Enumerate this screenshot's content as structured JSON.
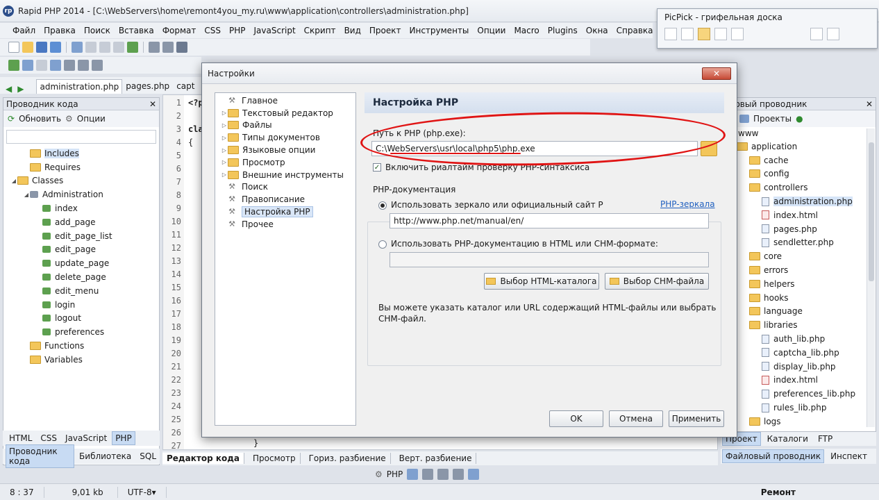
{
  "window": {
    "title": "Rapid PHP 2014 - [C:\\WebServers\\home\\remont4you_my.ru\\www\\application\\controllers\\administration.php]",
    "logo": "rp"
  },
  "menu": [
    "Файл",
    "Правка",
    "Поиск",
    "Вставка",
    "Формат",
    "CSS",
    "PHP",
    "JavaScript",
    "Скрипт",
    "Вид",
    "Проект",
    "Инструменты",
    "Опции",
    "Macro",
    "Plugins",
    "Окна",
    "Справка"
  ],
  "tabs": [
    {
      "label": "administration.php"
    },
    {
      "label": "pages.php"
    },
    {
      "label": "capt"
    }
  ],
  "left_panel": {
    "title": "Проводник кода",
    "close": "✕",
    "refresh": "Обновить",
    "options": "Опции",
    "tree": [
      {
        "label": "Includes",
        "indent": 1,
        "kind": "folder",
        "selected": true
      },
      {
        "label": "Requires",
        "indent": 1,
        "kind": "folder"
      },
      {
        "label": "Classes",
        "indent": 0,
        "kind": "folder",
        "arrow": "◢"
      },
      {
        "label": "Administration",
        "indent": 1,
        "kind": "class",
        "arrow": "◢"
      },
      {
        "label": "index",
        "indent": 2,
        "kind": "fn"
      },
      {
        "label": "add_page",
        "indent": 2,
        "kind": "fn"
      },
      {
        "label": "edit_page_list",
        "indent": 2,
        "kind": "fn"
      },
      {
        "label": "edit_page",
        "indent": 2,
        "kind": "fn"
      },
      {
        "label": "update_page",
        "indent": 2,
        "kind": "fn"
      },
      {
        "label": "delete_page",
        "indent": 2,
        "kind": "fn"
      },
      {
        "label": "edit_menu",
        "indent": 2,
        "kind": "fn"
      },
      {
        "label": "login",
        "indent": 2,
        "kind": "fn"
      },
      {
        "label": "logout",
        "indent": 2,
        "kind": "fn"
      },
      {
        "label": "preferences",
        "indent": 2,
        "kind": "fn"
      },
      {
        "label": "Functions",
        "indent": 1,
        "kind": "folder"
      },
      {
        "label": "Variables",
        "indent": 1,
        "kind": "folder"
      }
    ],
    "bottom_tabs": [
      "HTML",
      "CSS",
      "JavaScript",
      "PHP"
    ],
    "bottom_tabs2": [
      "Проводник кода",
      "Библиотека",
      "SQL"
    ]
  },
  "editor": {
    "lines": [
      "1",
      "2",
      "3",
      "4",
      "5",
      "6",
      "7",
      "8",
      "9",
      "10",
      "11",
      "12",
      "13",
      "14",
      "15",
      "16",
      "17",
      "18",
      "19",
      "20",
      "21",
      "22",
      "23",
      "24",
      "25",
      "26",
      "27"
    ],
    "code": {
      "l1": "<?p",
      "l3": "cla",
      "l4": "{",
      "l27": "}"
    },
    "bottom_tabs": [
      "Редактор кода",
      "Просмотр",
      "Гориз. разбиение",
      "Верт. разбиение"
    ]
  },
  "right_panel": {
    "title": "йловый проводник",
    "close": "✕",
    "projects": "Проекты",
    "root": "www",
    "tree": [
      {
        "label": "application",
        "indent": 0,
        "kind": "folder"
      },
      {
        "label": "cache",
        "indent": 1,
        "kind": "folder"
      },
      {
        "label": "config",
        "indent": 1,
        "kind": "folder"
      },
      {
        "label": "controllers",
        "indent": 1,
        "kind": "folder"
      },
      {
        "label": "administration.php",
        "indent": 2,
        "kind": "php",
        "selected": true
      },
      {
        "label": "index.html",
        "indent": 2,
        "kind": "html"
      },
      {
        "label": "pages.php",
        "indent": 2,
        "kind": "php"
      },
      {
        "label": "sendletter.php",
        "indent": 2,
        "kind": "php"
      },
      {
        "label": "core",
        "indent": 1,
        "kind": "folder"
      },
      {
        "label": "errors",
        "indent": 1,
        "kind": "folder"
      },
      {
        "label": "helpers",
        "indent": 1,
        "kind": "folder"
      },
      {
        "label": "hooks",
        "indent": 1,
        "kind": "folder"
      },
      {
        "label": "language",
        "indent": 1,
        "kind": "folder"
      },
      {
        "label": "libraries",
        "indent": 1,
        "kind": "folder"
      },
      {
        "label": "auth_lib.php",
        "indent": 2,
        "kind": "php"
      },
      {
        "label": "captcha_lib.php",
        "indent": 2,
        "kind": "php"
      },
      {
        "label": "display_lib.php",
        "indent": 2,
        "kind": "php"
      },
      {
        "label": "index.html",
        "indent": 2,
        "kind": "html"
      },
      {
        "label": "preferences_lib.php",
        "indent": 2,
        "kind": "php"
      },
      {
        "label": "rules_lib.php",
        "indent": 2,
        "kind": "php"
      },
      {
        "label": "logs",
        "indent": 1,
        "kind": "folder"
      }
    ],
    "bottom_tabs": [
      "Проект",
      "Каталоги",
      "FTP"
    ],
    "bottom_tabs2": [
      "Файловый проводник",
      "Инспект"
    ]
  },
  "picpick": {
    "title": "PicPick - грифельная доска"
  },
  "dialog": {
    "title": "Настройки",
    "close": "✕",
    "tree": [
      {
        "label": "Главное",
        "kind": "wrench"
      },
      {
        "label": "Текстовый редактор",
        "kind": "folder",
        "arrow": "▷"
      },
      {
        "label": "Файлы",
        "kind": "folder",
        "arrow": "▷"
      },
      {
        "label": "Типы документов",
        "kind": "folder",
        "arrow": "▷"
      },
      {
        "label": "Языковые опции",
        "kind": "folder",
        "arrow": "▷"
      },
      {
        "label": "Просмотр",
        "kind": "folder",
        "arrow": "▷"
      },
      {
        "label": "Внешние инструменты",
        "kind": "folder",
        "arrow": "▷"
      },
      {
        "label": "Поиск",
        "kind": "wrench"
      },
      {
        "label": "Правописание",
        "kind": "wrench"
      },
      {
        "label": "Настройка PHP",
        "kind": "wrench",
        "selected": true
      },
      {
        "label": "Прочее",
        "kind": "wrench"
      }
    ],
    "section_title": "Настройка PHP",
    "php_path_label": "Путь к PHP (php.exe):",
    "php_path_value": "C:\\WebServers\\usr\\local\\php5\\php.exe",
    "realtime_check_label": "Включить риалтайм проверку PHP-синтаксиса",
    "realtime_check_mark": "✓",
    "realtime_checked": true,
    "doc_group_label": "PHP-документация",
    "radio_mirror_label": "Использовать зеркало или официальный сайт Р",
    "mirror_link": "PHP-зеркала",
    "mirror_url": "http://www.php.net/manual/en/",
    "radio_local_label": "Использовать PHP-документацию в HTML или CHM-формате:",
    "local_path": "",
    "btn_html_dir": "Выбор HTML-каталога",
    "btn_chm": "Выбор CHM-файла",
    "hint_line1": "Вы можете указать каталог или URL содержащий HTML-файлы или выбрать",
    "hint_line2": "CHM-файл.",
    "btn_ok": "OK",
    "btn_cancel": "Отмена",
    "btn_apply": "Применить"
  },
  "bottom_toolbar": {
    "php_label": "PHP"
  },
  "status": {
    "position": "8 : 37",
    "size": "9,01 kb",
    "encoding": "UTF-8",
    "encoding_arrow": "▾",
    "watermark": "Ремонт"
  },
  "colors": {
    "annotation": "#e01414",
    "accent": "#2c4e8a"
  }
}
